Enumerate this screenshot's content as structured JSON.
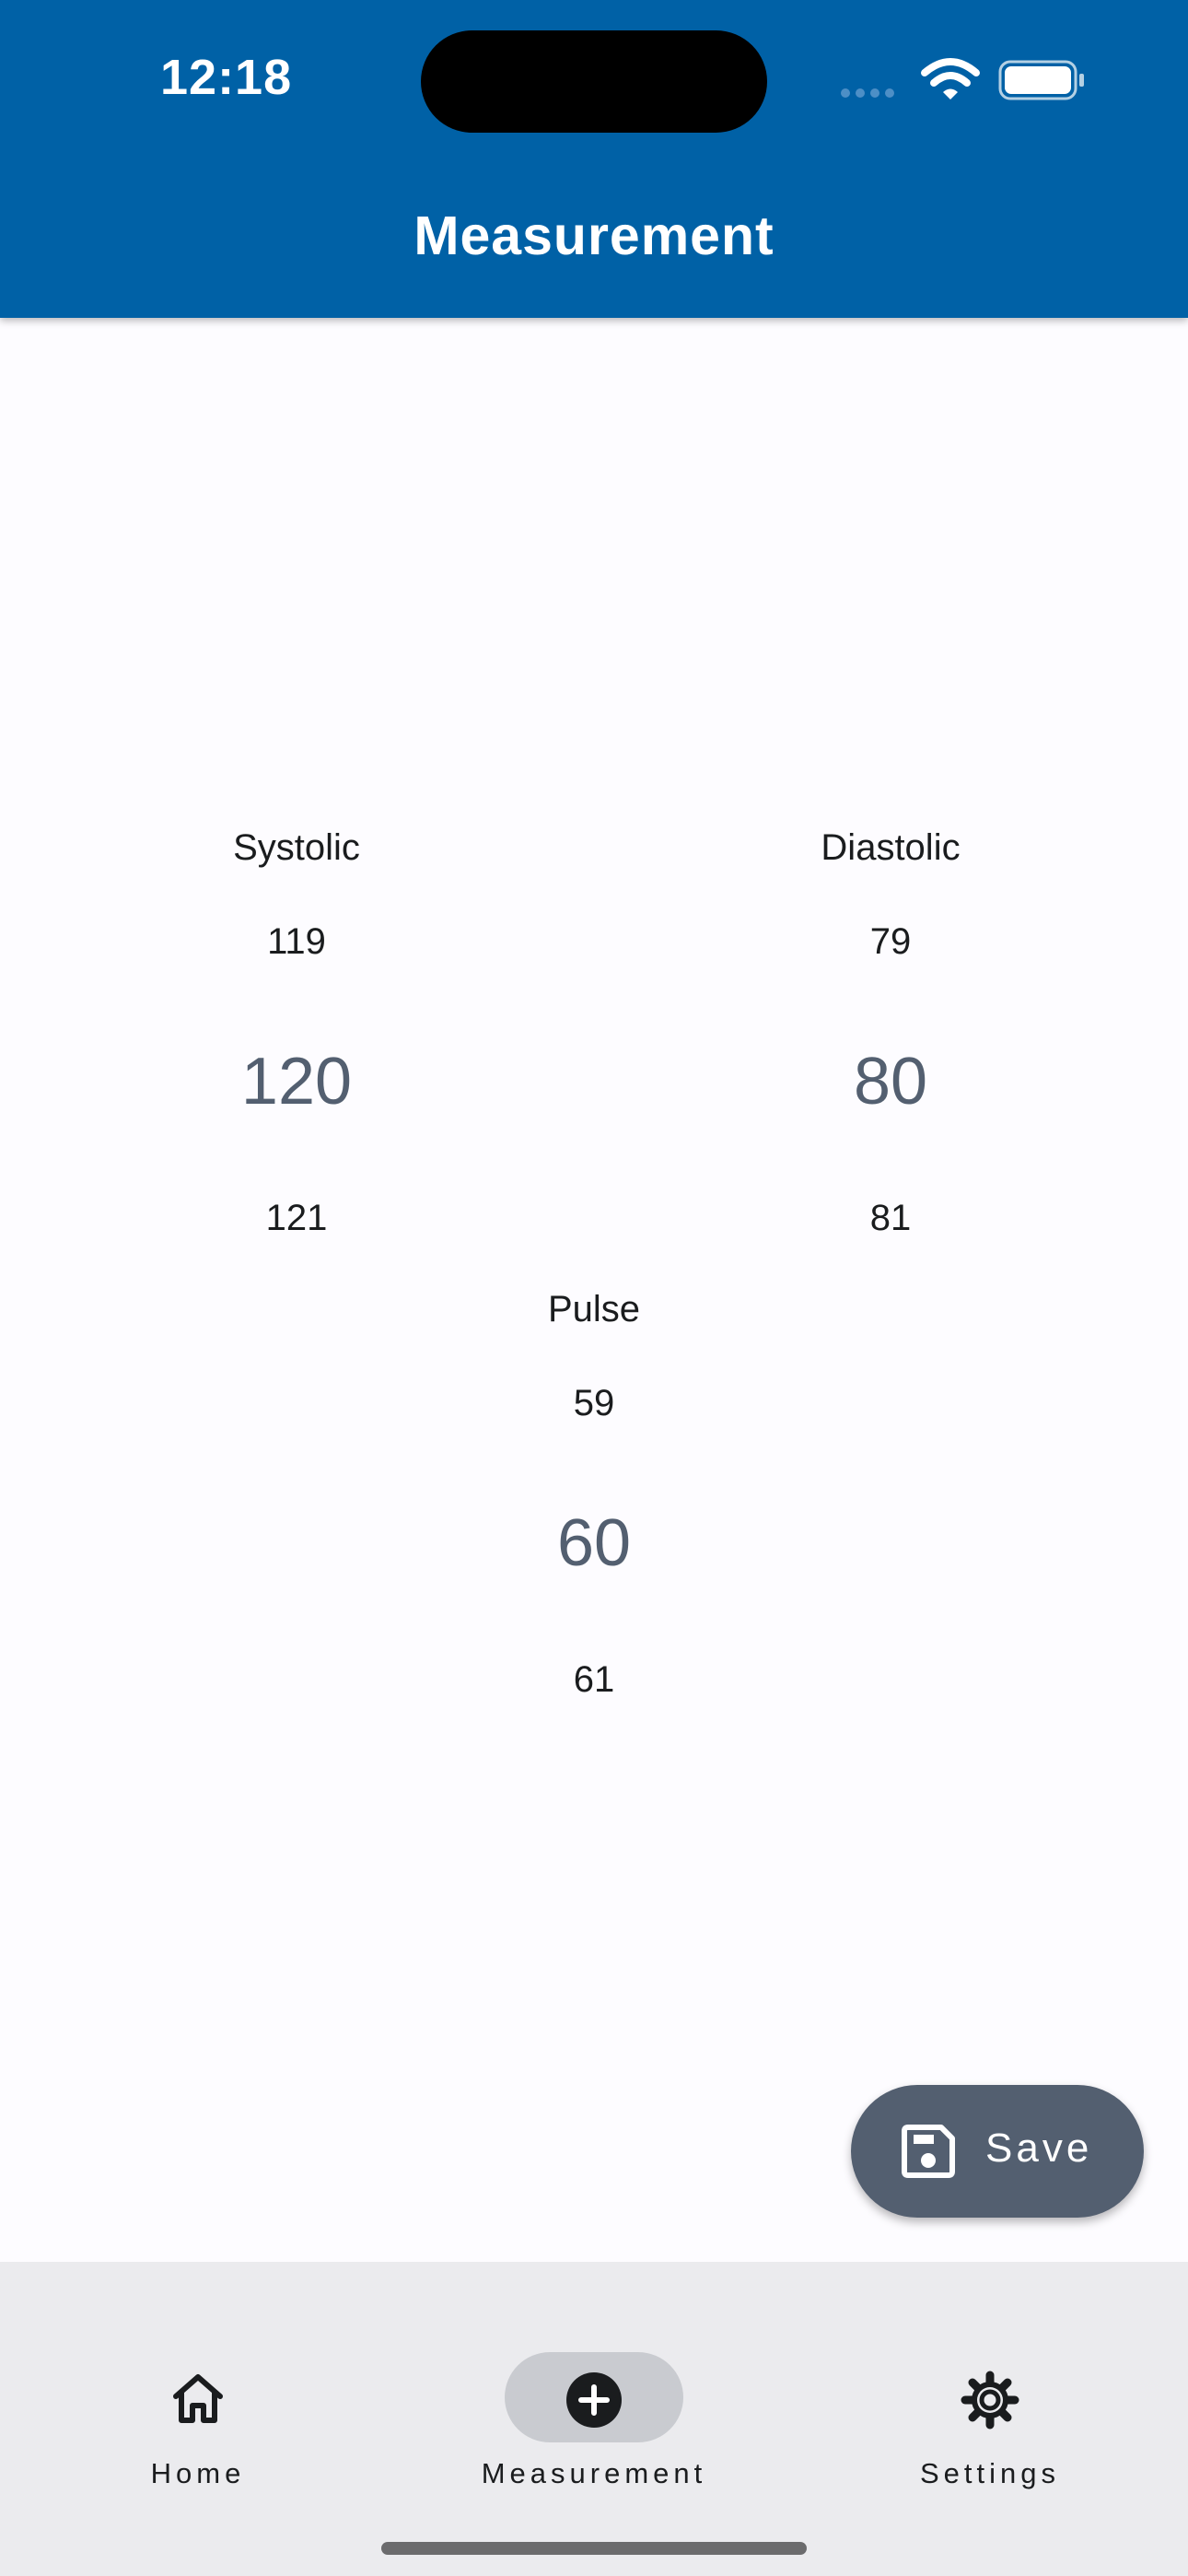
{
  "status_bar": {
    "time": "12:18"
  },
  "app_bar": {
    "title": "Measurement"
  },
  "pickers": {
    "systolic": {
      "label": "Systolic",
      "prev": "119",
      "selected": "120",
      "next": "121"
    },
    "diastolic": {
      "label": "Diastolic",
      "prev": "79",
      "selected": "80",
      "next": "81"
    },
    "pulse": {
      "label": "Pulse",
      "prev": "59",
      "selected": "60",
      "next": "61"
    }
  },
  "fab": {
    "label": "Save",
    "icon": "save-icon"
  },
  "nav": {
    "items": [
      {
        "label": "Home",
        "icon": "home-icon"
      },
      {
        "label": "Measurement",
        "icon": "add-circle-icon"
      },
      {
        "label": "Settings",
        "icon": "gear-icon"
      }
    ],
    "selected_index": 1
  },
  "colors": {
    "app_bar": "#0061a6",
    "selected_value": "#535f70",
    "fab": "#535f70",
    "nav_background": "#ebebee",
    "nav_indicator": "#c9cbd0"
  }
}
